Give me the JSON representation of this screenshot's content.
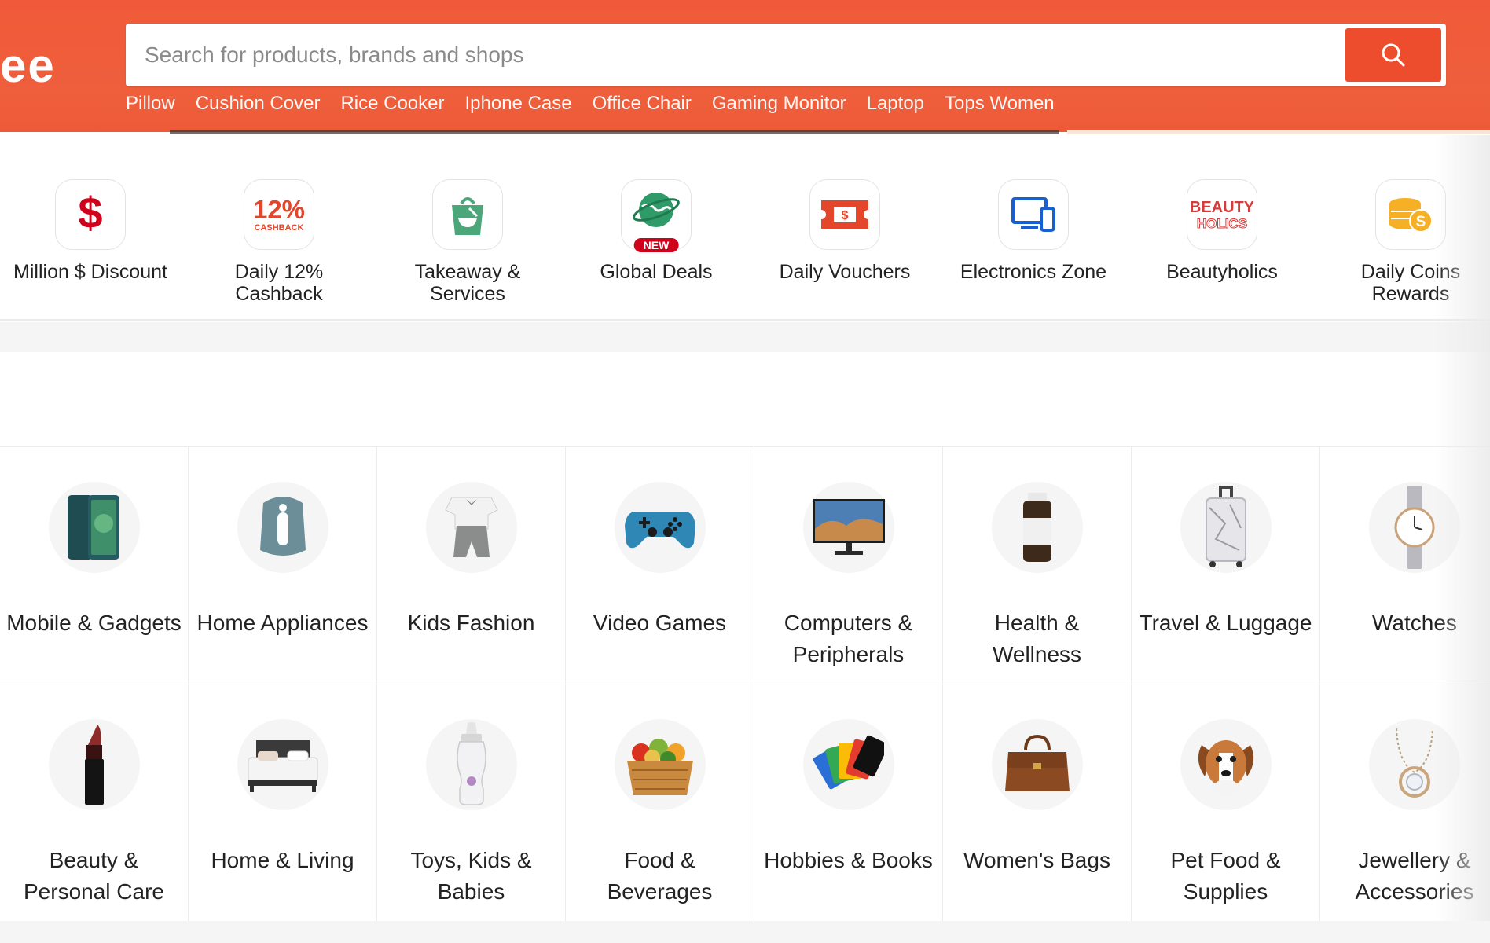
{
  "header": {
    "logo_fragment": "ee",
    "search": {
      "placeholder": "Search for products, brands and shops",
      "value": ""
    },
    "hints": [
      "Pillow",
      "Cushion Cover",
      "Rice Cooker",
      "Iphone Case",
      "Office Chair",
      "Gaming Monitor",
      "Laptop",
      "Tops Women"
    ]
  },
  "quick_links": [
    {
      "label": "Million $ Discount",
      "icon": "dollar-icon"
    },
    {
      "label": "Daily 12% Cashback",
      "icon": "cashback-icon",
      "icon_text": "12%",
      "icon_subtext": "CASHBACK"
    },
    {
      "label": "Takeaway & Services",
      "icon": "takeaway-bag-icon"
    },
    {
      "label": "Global Deals",
      "icon": "globe-icon",
      "badge": "NEW"
    },
    {
      "label": "Daily Vouchers",
      "icon": "voucher-icon"
    },
    {
      "label": "Electronics Zone",
      "icon": "devices-icon"
    },
    {
      "label": "Beautyholics",
      "icon": "beautyholics-logo-icon",
      "icon_text": "BEAUTY HOLICS"
    },
    {
      "label": "Daily Coins Rewards",
      "icon": "coins-icon"
    }
  ],
  "categories": [
    {
      "label": "Mobile & Gadgets",
      "icon": "smartphone-icon"
    },
    {
      "label": "Home Appliances",
      "icon": "air-fryer-icon"
    },
    {
      "label": "Kids Fashion",
      "icon": "kids-outfit-icon"
    },
    {
      "label": "Video Games",
      "icon": "gamepad-icon"
    },
    {
      "label": "Computers & Peripherals",
      "icon": "monitor-icon"
    },
    {
      "label": "Health & Wellness",
      "icon": "supplement-bottle-icon"
    },
    {
      "label": "Travel & Luggage",
      "icon": "suitcase-icon"
    },
    {
      "label": "Watches",
      "icon": "wristwatch-icon"
    },
    {
      "label": "Beauty & Personal Care",
      "icon": "lipstick-icon"
    },
    {
      "label": "Home & Living",
      "icon": "bed-icon"
    },
    {
      "label": "Toys, Kids & Babies",
      "icon": "baby-bottle-icon"
    },
    {
      "label": "Food & Beverages",
      "icon": "food-basket-icon"
    },
    {
      "label": "Hobbies & Books",
      "icon": "playing-cards-icon"
    },
    {
      "label": "Women's Bags",
      "icon": "handbag-icon"
    },
    {
      "label": "Pet Food & Supplies",
      "icon": "dog-icon"
    },
    {
      "label": "Jewellery & Accessories",
      "icon": "necklace-icon"
    }
  ],
  "colors": {
    "brand": "#ee4d2d",
    "header_bg": "#ef5c3a",
    "border": "#ececec",
    "band": "#f5f5f5"
  }
}
